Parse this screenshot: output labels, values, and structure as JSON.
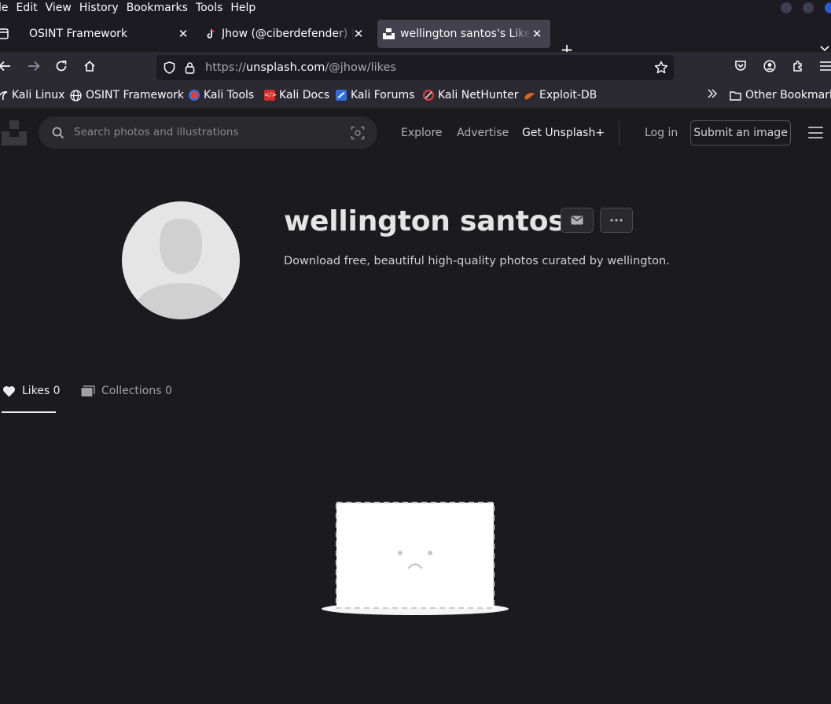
{
  "browser": {
    "menu": [
      "le",
      "Edit",
      "View",
      "History",
      "Bookmarks",
      "Tools",
      "Help"
    ],
    "tabs": [
      {
        "label": "OSINT Framework",
        "active": false
      },
      {
        "label": "Jhow (@ciberdefender) | T",
        "active": false
      },
      {
        "label": "wellington santos's Likes",
        "active": true
      }
    ],
    "url_prefix": "https://",
    "url_domain": "unsplash.com",
    "url_path": "/@jhow/likes",
    "bookmarks": [
      {
        "label": "Kali Linux"
      },
      {
        "label": "OSINT Framework"
      },
      {
        "label": "Kali Tools"
      },
      {
        "label": "Kali Docs"
      },
      {
        "label": "Kali Forums"
      },
      {
        "label": "Kali NetHunter"
      },
      {
        "label": "Exploit-DB"
      }
    ],
    "other_bookmarks": "Other Bookmarks"
  },
  "header": {
    "search_placeholder": "Search photos and illustrations",
    "nav": [
      "Explore",
      "Advertise",
      "Get Unsplash+"
    ],
    "login": "Log in",
    "submit": "Submit an image"
  },
  "profile": {
    "name": "wellington santos",
    "bio": "Download free, beautiful high-quality photos curated by wellington."
  },
  "profile_tabs": [
    {
      "label": "Likes 0",
      "active": true
    },
    {
      "label": "Collections 0",
      "active": false
    }
  ],
  "colors": {
    "page_bg": "#1b1b1d",
    "browser_toolbar": "#2b2a33",
    "active_tab": "#42414d"
  }
}
